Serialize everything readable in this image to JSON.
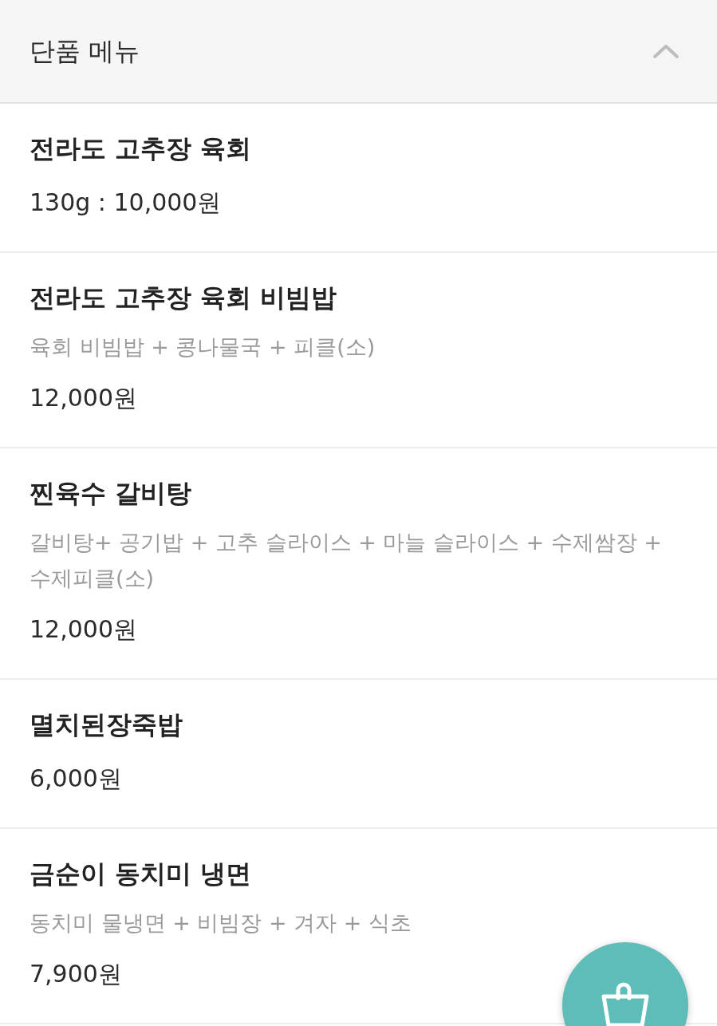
{
  "section": {
    "title": "단품 메뉴",
    "expanded": true
  },
  "items": [
    {
      "name": "전라도 고추장 육회",
      "price": "130g : 10,000원"
    },
    {
      "name": "전라도 고추장 육회 비빔밥",
      "description": "육회 비빔밥 + 콩나물국 + 피클(소)",
      "price": "12,000원"
    },
    {
      "name": "찐육수 갈비탕",
      "description": "갈비탕+ 공기밥 + 고추 슬라이스 + 마늘 슬라이스 + 수제쌈장 + 수제피클(소)",
      "price": "12,000원"
    },
    {
      "name": "멸치된장죽밥",
      "price": "6,000원"
    },
    {
      "name": "금순이 동치미 냉면",
      "description": "동치미 물냉면 + 비빔장 + 겨자 + 식초",
      "price": "7,900원"
    }
  ]
}
